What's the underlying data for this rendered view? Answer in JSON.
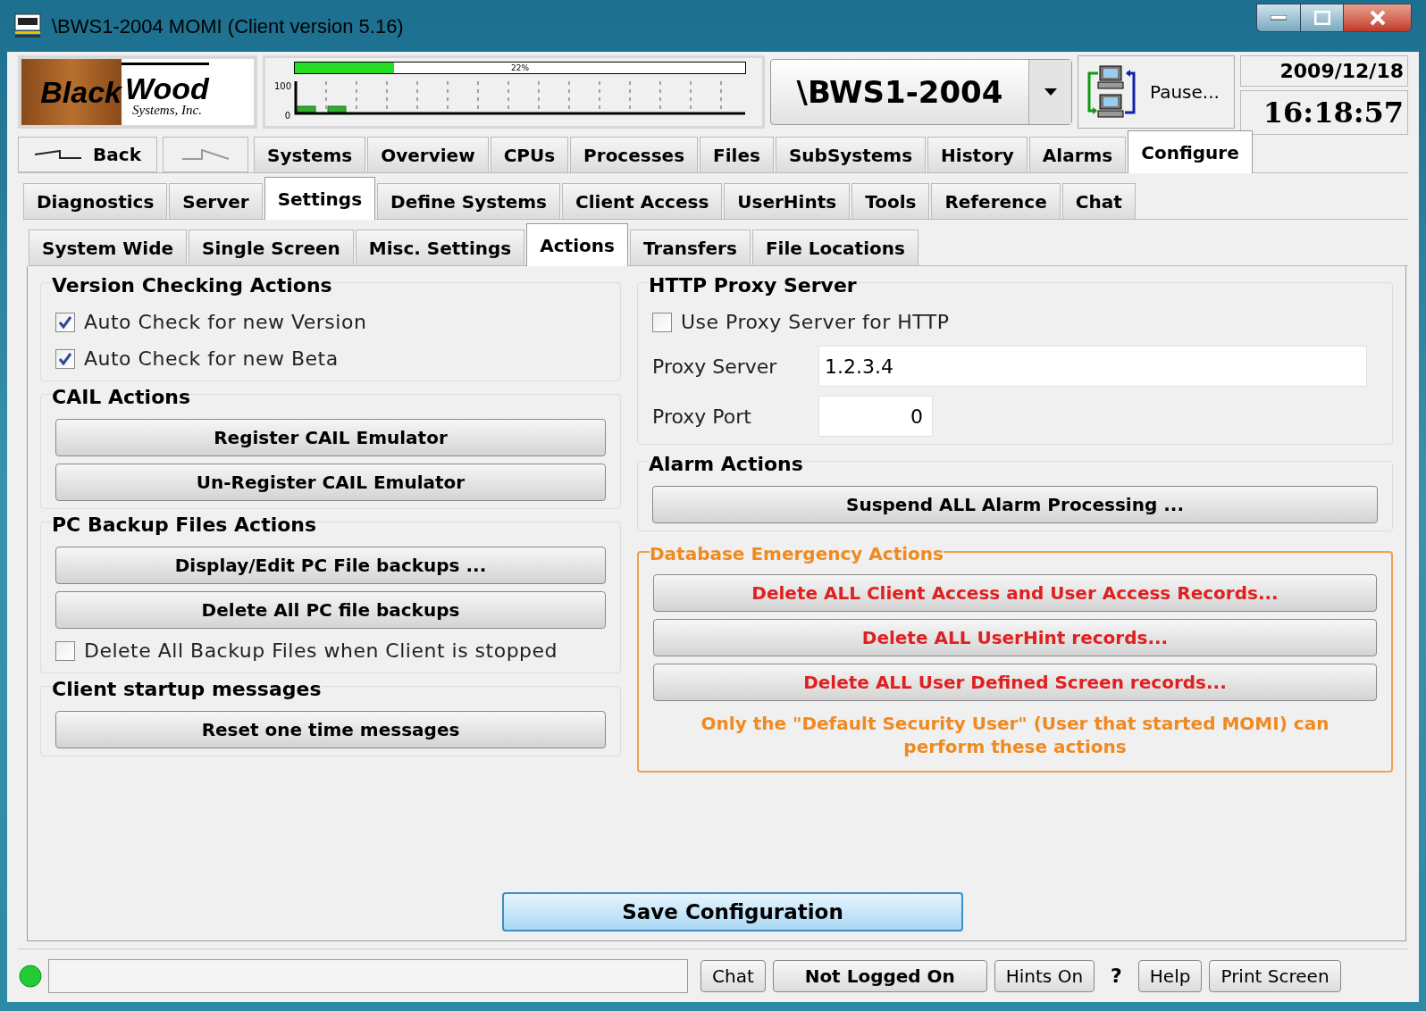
{
  "window": {
    "title": "\\BWS1-2004 MOMI (Client version 5.16)"
  },
  "logo": {
    "word_1": "Black",
    "word_2": "Wood",
    "tagline": "Systems, Inc."
  },
  "cpu_meter": {
    "level": 0.22,
    "reading": "22%",
    "axis_max": "100",
    "axis_min": "0"
  },
  "system_selector": {
    "value": "\\BWS1-2004"
  },
  "pause_button": {
    "label": "Pause..."
  },
  "date": "2009/12/18",
  "time": "16:18:57",
  "back_button": {
    "label": "Back"
  },
  "main_tabs": [
    {
      "label": "Systems",
      "selected": false
    },
    {
      "label": "Overview",
      "selected": false
    },
    {
      "label": "CPUs",
      "selected": false
    },
    {
      "label": "Processes",
      "selected": false
    },
    {
      "label": "Files",
      "selected": false
    },
    {
      "label": "SubSystems",
      "selected": false
    },
    {
      "label": "History",
      "selected": false
    },
    {
      "label": "Alarms",
      "selected": false
    },
    {
      "label": "Configure",
      "selected": true
    }
  ],
  "configure_tabs": [
    {
      "label": "Diagnostics",
      "selected": false
    },
    {
      "label": "Server",
      "selected": false
    },
    {
      "label": "Settings",
      "selected": true
    },
    {
      "label": "Define Systems",
      "selected": false
    },
    {
      "label": "Client Access",
      "selected": false
    },
    {
      "label": "UserHints",
      "selected": false
    },
    {
      "label": "Tools",
      "selected": false
    },
    {
      "label": "Reference",
      "selected": false
    },
    {
      "label": "Chat",
      "selected": false
    }
  ],
  "settings_tabs": [
    {
      "label": "System Wide",
      "selected": false
    },
    {
      "label": "Single Screen",
      "selected": false
    },
    {
      "label": "Misc. Settings",
      "selected": false
    },
    {
      "label": "Actions",
      "selected": true
    },
    {
      "label": "Transfers",
      "selected": false
    },
    {
      "label": "File Locations",
      "selected": false
    }
  ],
  "left_groups": [
    {
      "title": "Version Checking Actions",
      "warning": false,
      "items": [
        {
          "kind": "checkbox",
          "label": "Auto Check for new Version",
          "checked": true
        },
        {
          "kind": "checkbox",
          "label": "Auto Check for new Beta",
          "checked": true
        }
      ]
    },
    {
      "title": "CAIL Actions",
      "warning": false,
      "items": [
        {
          "kind": "button",
          "label": "Register CAIL Emulator"
        },
        {
          "kind": "button",
          "label": "Un-Register CAIL Emulator"
        }
      ]
    },
    {
      "title": "PC Backup Files Actions",
      "warning": false,
      "items": [
        {
          "kind": "button",
          "label": "Display/Edit PC File backups ..."
        },
        {
          "kind": "button",
          "label": "Delete All PC file backups"
        },
        {
          "kind": "checkbox",
          "label": "Delete All Backup Files when Client is stopped",
          "checked": false
        }
      ]
    },
    {
      "title": "Client startup messages",
      "warning": false,
      "items": [
        {
          "kind": "button",
          "label": "Reset one time messages"
        }
      ]
    }
  ],
  "right_groups": [
    {
      "title": "HTTP Proxy Server",
      "warning": false,
      "items": [
        {
          "kind": "checkbox",
          "label": "Use Proxy Server for HTTP",
          "checked": false
        },
        {
          "kind": "field",
          "label": "Proxy Server",
          "value": "1.2.3.4"
        },
        {
          "kind": "number_field",
          "label": "Proxy Port",
          "value": "0"
        }
      ]
    },
    {
      "title": "Alarm Actions",
      "warning": false,
      "items": [
        {
          "kind": "button",
          "label": "Suspend ALL Alarm Processing ..."
        }
      ]
    },
    {
      "title": "Database Emergency Actions",
      "warning": true,
      "items": [
        {
          "kind": "button",
          "label": "Delete ALL Client Access and User Access Records..."
        },
        {
          "kind": "button",
          "label": "Delete ALL UserHint records..."
        },
        {
          "kind": "button",
          "label": "Delete ALL User Defined Screen records..."
        },
        {
          "kind": "note",
          "label": "Only the \"Default Security User\" (User that started MOMI) can perform these actions"
        }
      ]
    }
  ],
  "save_button": {
    "label": "Save Configuration"
  },
  "status_bar": [
    {
      "kind": "button",
      "label": "Chat"
    },
    {
      "kind": "bold_button",
      "label": "Not Logged On"
    },
    {
      "kind": "button",
      "label": "Hints On"
    },
    {
      "kind": "text",
      "label": "?"
    },
    {
      "kind": "button",
      "label": "Help"
    },
    {
      "kind": "button",
      "label": "Print Screen"
    }
  ]
}
